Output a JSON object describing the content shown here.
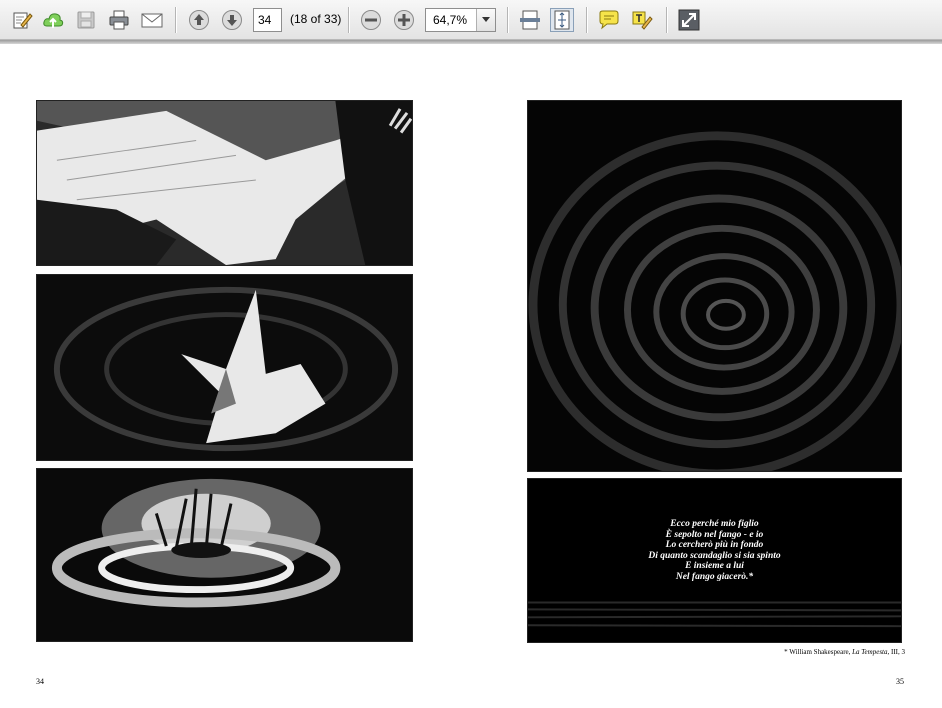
{
  "toolbar": {
    "buttons": [
      {
        "name": "edit-icon"
      },
      {
        "name": "upload-icon"
      },
      {
        "name": "save-icon"
      },
      {
        "name": "print-icon"
      },
      {
        "name": "email-icon"
      },
      {
        "name": "previous-page-icon"
      },
      {
        "name": "next-page-icon"
      },
      {
        "name": "zoom-out-icon"
      },
      {
        "name": "zoom-in-icon"
      },
      {
        "name": "fit-width-icon"
      },
      {
        "name": "fit-page-icon"
      },
      {
        "name": "comment-icon"
      },
      {
        "name": "highlight-text-icon"
      },
      {
        "name": "fullscreen-icon"
      }
    ],
    "current_page": "34",
    "page_count": "(18 of 33)",
    "zoom": "64,7%"
  },
  "document": {
    "left_page_number": "34",
    "right_page_number": "35",
    "quote_lines": [
      "Ecco perché mio figlio",
      "È sepolto nel fango - e io",
      "Lo cercherò più in fondo",
      "Di quanto scandaglio si sia spinto",
      "E insieme a lui",
      "Nel fango giacerò.*"
    ],
    "footnote_prefix": "* William Shakespeare,",
    "footnote_title": "La Tempesta",
    "footnote_suffix": ", III, 3"
  },
  "colors": {
    "toolbar_bg": "#ebebeb",
    "page_bg": "#ffffff",
    "ink": "#000000"
  }
}
